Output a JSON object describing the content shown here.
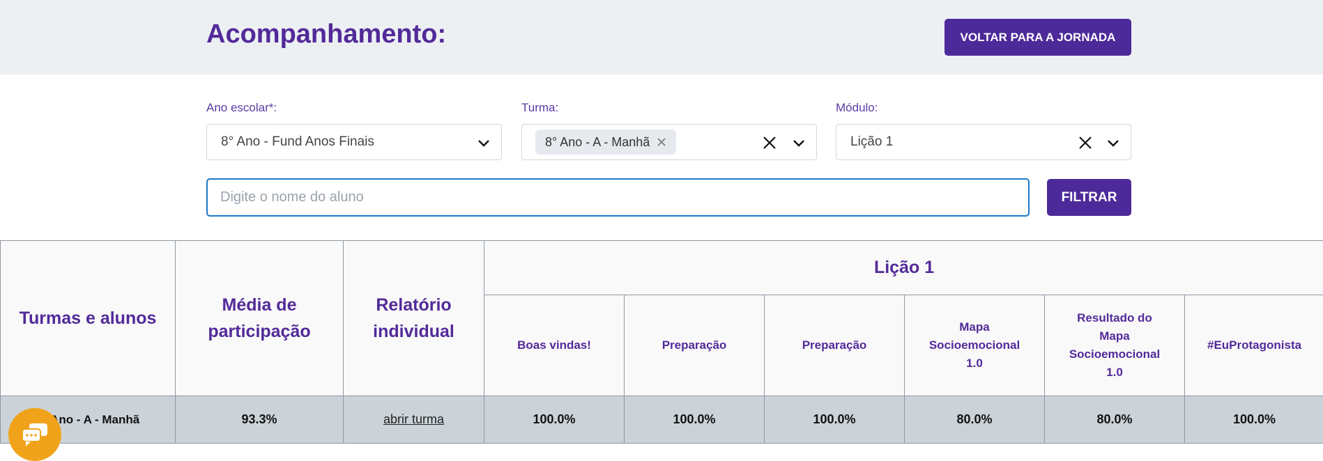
{
  "header": {
    "title": "Acompanhamento:",
    "back_button": "VOLTAR PARA A JORNADA"
  },
  "filters": {
    "ano_label": "Ano escolar*:",
    "ano_value": "8° Ano - Fund Anos Finais",
    "turma_label": "Turma:",
    "turma_chip": "8° Ano - A - Manhã",
    "modulo_label": "Módulo:",
    "modulo_value": "Lição 1",
    "search_placeholder": "Digite o nome do aluno",
    "filter_button": "FILTRAR"
  },
  "table": {
    "col_turmas": "Turmas e alunos",
    "col_media_1": "Média de",
    "col_media_2": "participação",
    "col_relatorio_1": "Relatório",
    "col_relatorio_2": "individual",
    "lesson_title": "Lição 1",
    "activities": [
      [
        "Boas vindas!"
      ],
      [
        "Preparação"
      ],
      [
        "Preparação"
      ],
      [
        "Mapa",
        "Socioemocional",
        "1.0"
      ],
      [
        "Resultado do",
        "Mapa",
        "Socioemocional",
        "1.0"
      ],
      [
        "#EuProtagonista"
      ]
    ],
    "rows": [
      {
        "name": "8° Ano - A - Manhã",
        "media": "93.3%",
        "relatorio_link": "abrir turma",
        "values": [
          "100.0%",
          "100.0%",
          "100.0%",
          "80.0%",
          "80.0%",
          "100.0%"
        ]
      }
    ]
  },
  "colors": {
    "primary": "#4d2a99",
    "title": "#522a99",
    "row_bg": "#cbd3d9",
    "chat": "#f0a31a"
  },
  "icons": {
    "chevron": "chevron-down-icon",
    "clear": "close-icon",
    "chat": "chat-icon"
  }
}
